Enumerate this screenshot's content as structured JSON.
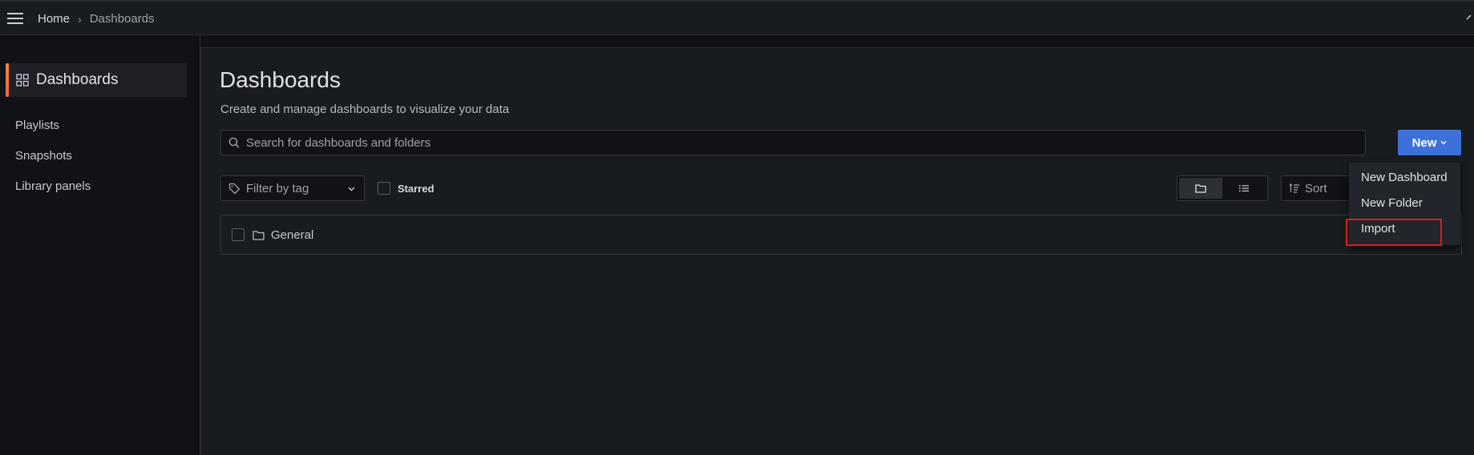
{
  "topbar": {
    "breadcrumb": {
      "home": "Home",
      "separator": "›",
      "current": "Dashboards"
    }
  },
  "sidebar": {
    "active_label": "Dashboards",
    "items": [
      {
        "label": "Playlists"
      },
      {
        "label": "Snapshots"
      },
      {
        "label": "Library panels"
      }
    ]
  },
  "main": {
    "title": "Dashboards",
    "subtitle": "Create and manage dashboards to visualize your data",
    "search": {
      "placeholder": "Search for dashboards and folders",
      "value": ""
    },
    "new_button_label": "New",
    "filter": {
      "label": "Filter by tag"
    },
    "starred_label": "Starred",
    "view_mode": "folder",
    "sort_label": "Sort",
    "folders": [
      {
        "label": "General"
      }
    ]
  },
  "new_menu": {
    "items": [
      {
        "label": "New Dashboard"
      },
      {
        "label": "New Folder"
      },
      {
        "label": "Import"
      }
    ],
    "highlighted": "Import",
    "highlight_color": "#e31b1b"
  },
  "colors": {
    "accent": "#3d71d9",
    "active_bar": "#ff8833",
    "background": "#111217",
    "panel": "#181b1f"
  }
}
